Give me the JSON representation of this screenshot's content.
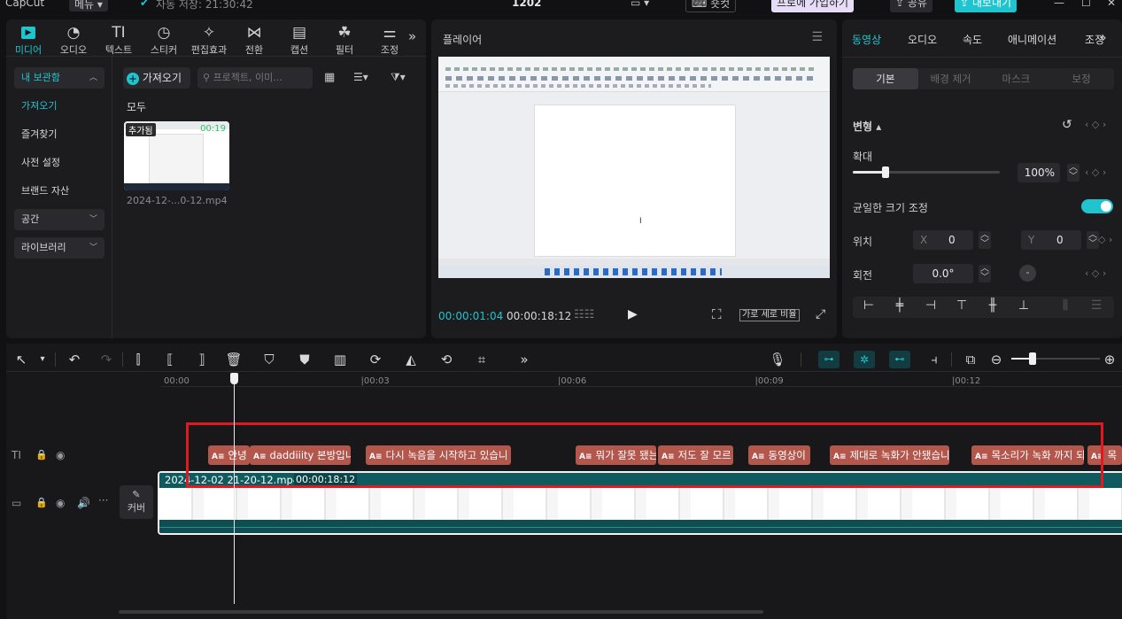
{
  "titlebar": {
    "app_name": "CapCut",
    "menu_label": "메뉴",
    "autosave": "자동 저장: 21:30:42",
    "project_title": "1202",
    "shortcut_label": "숏컷",
    "pro_label": "프로에 가입하기",
    "share_label": "공유",
    "export_label": "내보내기"
  },
  "media_tabs": [
    {
      "label": "미디어",
      "icon": "media-icon"
    },
    {
      "label": "오디오",
      "icon": "audio-icon"
    },
    {
      "label": "텍스트",
      "icon": "text-icon"
    },
    {
      "label": "스티커",
      "icon": "sticker-icon"
    },
    {
      "label": "편집효과",
      "icon": "effects-icon"
    },
    {
      "label": "전환",
      "icon": "transition-icon"
    },
    {
      "label": "캡션",
      "icon": "caption-icon"
    },
    {
      "label": "필터",
      "icon": "filter-icon"
    },
    {
      "label": "조정",
      "icon": "adjust-icon"
    }
  ],
  "media_tab_text_glyph": "TI",
  "more_tabs_glyph": "»",
  "sidebar": {
    "my_storage": "내 보관함",
    "items": [
      "가져오기",
      "즐겨찾기",
      "사전 설정",
      "브랜드 자산"
    ],
    "space": "공간",
    "library": "라이브러리"
  },
  "media_panel": {
    "import_label": "가져오기",
    "search_placeholder": "프로젝트, 이미...",
    "all_label": "모두",
    "clip_badge": "추가됨",
    "clip_duration": "00:19",
    "clip_name": "2024-12-...0-12.mp4"
  },
  "player": {
    "title": "플레이어",
    "current_time": "00:00:01:04",
    "total_time": "00:00:18:12",
    "ratio_label": "가로 세로 비율"
  },
  "inspector": {
    "tabs": [
      "동영상",
      "오디오",
      "속도",
      "애니메이션",
      "조정"
    ],
    "subtabs": [
      "기본",
      "배경 제거",
      "마스크",
      "보정"
    ],
    "transform_label": "변형",
    "scale_label": "확대",
    "scale_value": "100%",
    "scale_level": 0.22,
    "uniform_label": "균일한 크기 조정",
    "position_label": "위치",
    "pos_x_label": "X",
    "pos_x": "0",
    "pos_y_label": "Y",
    "pos_y": "0",
    "rotation_label": "회전",
    "rotation_value": "0.0°"
  },
  "timeline": {
    "ruler": [
      "00:00",
      "|00:03",
      "|00:06",
      "|00:09",
      "|00:12"
    ],
    "video_clip_name": "2024-12-02 21-20-12.mp4",
    "video_clip_duration": "00:00:18:12",
    "cover_label": "커버",
    "text_clips": [
      "안녕",
      "daddiiity 본방입니",
      "다시 녹음을 시작하고 있습니",
      "뭐가 잘못 됐는",
      "저도 잘 모르",
      "동영상이",
      "제대로 녹화가 안됐습니",
      "목소리가 녹화 까지 되",
      "목"
    ],
    "text_clip_badge": "A≡"
  },
  "colors": {
    "accent": "#20c4cf",
    "caption_clip": "#b3564c",
    "video_clip": "#0f5a5e",
    "highlight_box": "#e0181f"
  }
}
